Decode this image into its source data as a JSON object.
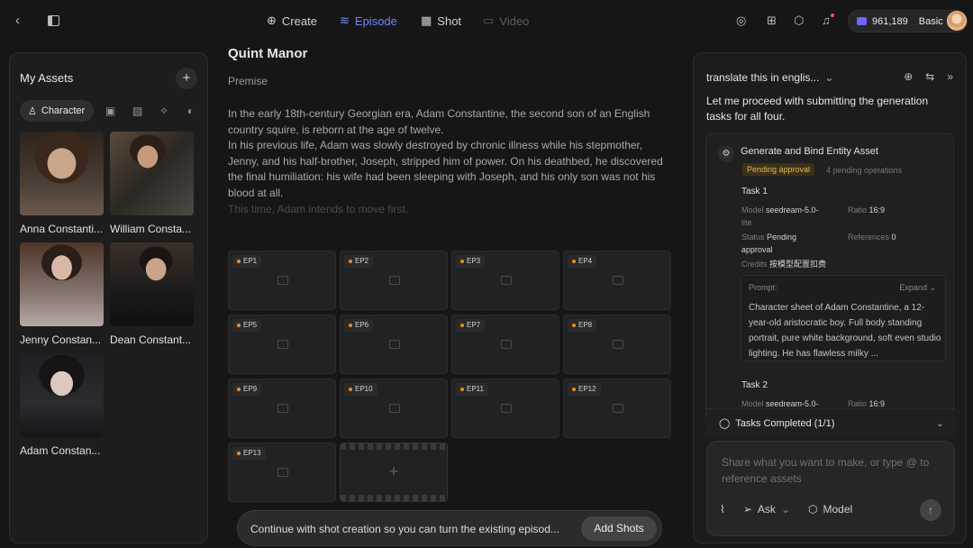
{
  "topbar": {
    "nav": [
      {
        "label": "Create",
        "icon": "plus-circle-icon"
      },
      {
        "label": "Episode",
        "icon": "layers-icon"
      },
      {
        "label": "Shot",
        "icon": "grid-icon"
      },
      {
        "label": "Video",
        "icon": "video-icon"
      }
    ],
    "credits": "961,189",
    "plan": "Basic",
    "accent": "#6f86ff"
  },
  "assets": {
    "title": "My Assets",
    "filter_active": "Character",
    "characters": [
      {
        "name": "Anna Constanti..."
      },
      {
        "name": "William Consta..."
      },
      {
        "name": "Jenny Constan..."
      },
      {
        "name": "Dean Constant..."
      },
      {
        "name": "Adam Constan..."
      }
    ]
  },
  "project": {
    "title": "Quint Manor",
    "premise_label": "Premise",
    "paragraphs": [
      "In the early 18th-century Georgian era, Adam Constantine, the second son of an English country squire, is reborn at the age of twelve.",
      "In his previous life, Adam was slowly destroyed by chronic illness while his stepmother, Jenny, and his half-brother, Joseph, stripped him of power. On his deathbed, he discovered the final humiliation: his wife had been sleeping with Joseph, and his only son was not his blood at all.",
      "This time, Adam intends to move first."
    ],
    "episodes": [
      "EP1",
      "EP2",
      "EP3",
      "EP4",
      "EP5",
      "EP6",
      "EP7",
      "EP8",
      "EP9",
      "EP10",
      "EP11",
      "EP12",
      "EP13"
    ]
  },
  "toast": {
    "message": "Continue with shot creation so you can turn the existing episod...",
    "button": "Add Shots"
  },
  "assistant": {
    "header": "translate this in englis...",
    "message": "Let me proceed with submitting the generation tasks for all four.",
    "card": {
      "title": "Generate and Bind Entity Asset",
      "status_badge": "Pending approval",
      "ops": "4 pending operations",
      "task1": {
        "title": "Task 1",
        "model_label": "Model",
        "model": "seedream-5.0-",
        "model2": "lite",
        "ratio_label": "Ratio",
        "ratio": "16:9",
        "status_label": "Status",
        "status": "Pending",
        "status2": "approval",
        "refs_label": "References",
        "refs": "0",
        "credits_label": "Credits",
        "credits": "按模型配置扣费",
        "prompt_label": "Prompt:",
        "expand": "Expand",
        "prompt": "Character sheet of Adam Constantine, a 12-year-old aristocratic boy. Full body standing portrait, pure white background, soft even studio lighting. He has flawless milky ..."
      },
      "task2": {
        "title": "Task 2",
        "model_label": "Model",
        "model": "seedream-5.0-",
        "ratio_label": "Ratio",
        "ratio": "16:9"
      }
    },
    "tasks_completed": "Tasks Completed (1/1)",
    "composer_placeholder": "Share what you want to make, or type @ to reference assets",
    "ask": "Ask",
    "model": "Model"
  }
}
